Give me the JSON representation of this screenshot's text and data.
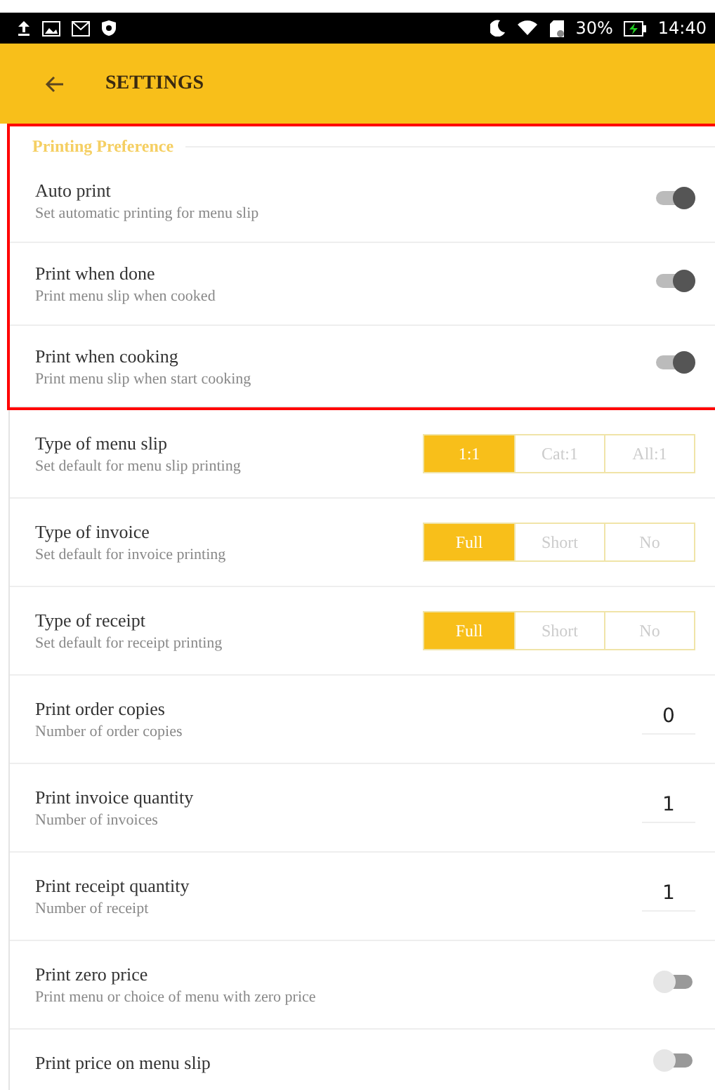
{
  "status_bar": {
    "battery": "30%",
    "time": "14:40"
  },
  "header": {
    "title": "SETTINGS"
  },
  "printing_preference": {
    "title": "Printing Preference",
    "items": [
      {
        "kind": "toggle",
        "title": "Auto print",
        "subtitle": "Set automatic printing for menu slip",
        "on": true
      },
      {
        "kind": "toggle",
        "title": "Print when done",
        "subtitle": "Print menu slip when cooked",
        "on": true
      },
      {
        "kind": "toggle",
        "title": "Print when cooking",
        "subtitle": "Print menu slip when start cooking",
        "on": true
      }
    ]
  },
  "settings": [
    {
      "kind": "segmented",
      "title": "Type of menu slip",
      "subtitle": "Set default for menu slip printing",
      "options": [
        {
          "label": "1:1",
          "selected": true
        },
        {
          "label": "Cat:1",
          "selected": false
        },
        {
          "label": "All:1",
          "selected": false
        }
      ]
    },
    {
      "kind": "segmented",
      "title": "Type of invoice",
      "subtitle": "Set default for invoice printing",
      "options": [
        {
          "label": "Full",
          "selected": true
        },
        {
          "label": "Short",
          "selected": false
        },
        {
          "label": "No",
          "selected": false
        }
      ]
    },
    {
      "kind": "segmented",
      "title": "Type of receipt",
      "subtitle": "Set default for receipt printing",
      "options": [
        {
          "label": "Full",
          "selected": true
        },
        {
          "label": "Short",
          "selected": false
        },
        {
          "label": "No",
          "selected": false
        }
      ]
    },
    {
      "kind": "number",
      "title": "Print order copies",
      "subtitle": "Number of order copies",
      "value": "0"
    },
    {
      "kind": "number",
      "title": "Print invoice quantity",
      "subtitle": "Number of invoices",
      "value": "1"
    },
    {
      "kind": "number",
      "title": "Print receipt quantity",
      "subtitle": "Number of receipt",
      "value": "1"
    },
    {
      "kind": "toggle",
      "title": "Print zero price",
      "subtitle": "Print menu or choice of menu with zero price",
      "on": false
    },
    {
      "kind": "toggle",
      "title": "Print price on menu slip",
      "on": false
    }
  ]
}
